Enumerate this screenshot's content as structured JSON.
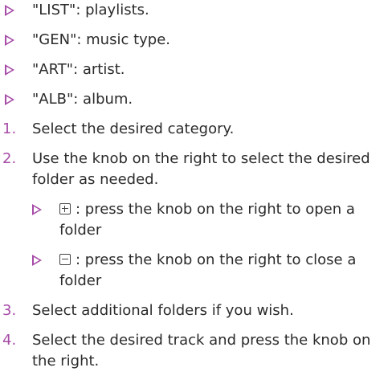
{
  "bullets": [
    "\"LIST\": playlists.",
    "\"GEN\": music type.",
    "\"ART\": artist.",
    "\"ALB\": album."
  ],
  "steps": [
    {
      "number": "1.",
      "text": "Select the desired category."
    },
    {
      "number": "2.",
      "text": "Use the knob on the right to select the desired folder as needed."
    },
    {
      "number": "3.",
      "text": "Select additional folders if you wish."
    },
    {
      "number": "4.",
      "text": "Select the desired track and press the knob on the right."
    }
  ],
  "sub_bullets": [
    {
      "icon": "plus-box-icon",
      "text": ": press the knob on the right to open a folder"
    },
    {
      "icon": "minus-box-icon",
      "text": ": press the knob on the right to close a folder"
    }
  ],
  "colors": {
    "accent": "#a64ca6",
    "text": "#2b2b2b"
  }
}
